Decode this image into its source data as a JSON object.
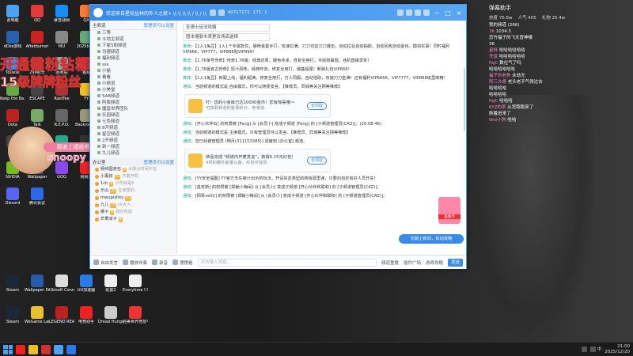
{
  "desktop": {
    "icons": [
      {
        "label": "此电脑",
        "color": "#4aa3f0"
      },
      {
        "label": "QQ",
        "color": "#e03a3a"
      },
      {
        "label": "暴雪战网",
        "color": "#148eff"
      },
      {
        "label": "QA",
        "color": "#ff7a30"
      },
      {
        "label": "dOss游戏",
        "color": "#2a60b0"
      },
      {
        "label": "Afterburner",
        "color": "#c22"
      },
      {
        "label": "MU",
        "color": "#888"
      },
      {
        "label": "2025birth",
        "color": "#6a7"
      },
      {
        "label": "ToDesk",
        "color": "#3a8ae8"
      },
      {
        "label": "299积分",
        "color": "#c33"
      },
      {
        "label": "回收站",
        "color": "#8aa"
      },
      {
        "label": "猫耳",
        "color": "#e33"
      },
      {
        "label": "Keep the Ba...",
        "color": "#6a4"
      },
      {
        "label": "ESCAPE",
        "color": "#444"
      },
      {
        "label": "RaidTee",
        "color": "#a33"
      },
      {
        "label": "YY",
        "color": "#f0c020"
      },
      {
        "label": "Dota",
        "color": "#b22"
      },
      {
        "label": "Talk",
        "color": "#7a6"
      },
      {
        "label": "R.E.P.O.",
        "color": "#666"
      },
      {
        "label": "Backrooms",
        "color": "#997"
      },
      {
        "label": "天下",
        "color": "#444"
      },
      {
        "label": "一起来飞车",
        "color": "#3a9"
      },
      {
        "label": "TorDesk",
        "color": "#2a8"
      },
      {
        "label": "Warframe",
        "color": "#333"
      },
      {
        "label": "NVIDIA",
        "color": "#7b2"
      },
      {
        "label": "Wallpaper",
        "color": "#556"
      },
      {
        "label": "GOG",
        "color": "#8a4ae8"
      },
      {
        "label": "网易云",
        "color": "#e22"
      },
      {
        "label": "Discord",
        "color": "#5865f2"
      },
      {
        "label": "腾讯会议",
        "color": "#2a6ae8"
      }
    ],
    "bottom_icons": [
      {
        "label": "Steam",
        "color": "#1b2838"
      },
      {
        "label": "Wallpaper Engine",
        "color": "#2a5aaa"
      },
      {
        "label": "Ubisoft Connect",
        "color": "#ddd"
      },
      {
        "label": "UU加速器",
        "color": "#2a7ae8"
      },
      {
        "label": "配置2",
        "color": "#eee"
      },
      {
        "label": "Everytime I See a DIN...",
        "color": "#eee"
      },
      {
        "label": "Steam",
        "color": "#1b2838"
      },
      {
        "label": "WeGame Launcher",
        "color": "#e8c030"
      },
      {
        "label": "LEGEND REAL",
        "color": "#b22"
      },
      {
        "label": "电竞助手",
        "color": "#e22"
      },
      {
        "label": "Dread Hunger",
        "color": "#ccc"
      },
      {
        "label": "完美世界竞技平台",
        "color": "#e33"
      }
    ],
    "overlay_line1": "开通钻粉钻粉钻",
    "overlay_line2": "15级牌牌粉丝",
    "sticker_tag": "感谢上墙投喂",
    "sticker_name": "snoopy"
  },
  "app": {
    "title": "欢迎来自星际丛林的外人之家+ \\\\ \\\\ \\\\ \\\\ / \\\\ / \\\\",
    "channel_id": "40717172",
    "online": "171",
    "members": "1",
    "sidebar": {
      "header_left": "主频道",
      "header_right": "管理员可以设置",
      "channels": [
        "三等",
        "斗地主频道",
        "下家5和频道",
        "功德频道",
        "福利频道",
        "sss",
        "小偷",
        "看看",
        "小频道",
        "小美堂",
        "5AB频道",
        "阿瓶频道",
        "魔兽世界团队",
        "乐园频道",
        "七色频道",
        "8开频道",
        "星空频道",
        "2开频道",
        "新一频道",
        "九儿频道"
      ],
      "sub_header_left": "办公室",
      "sub_header_right": "管理员可以设置",
      "users": [
        {
          "name": "杨帅圆克包",
          "tag": "8",
          "extra": "大部分时间不在"
        },
        {
          "name": "小黑叔",
          "tag": "51",
          "extra": "不能开机"
        },
        {
          "name": "1ch",
          "tag": "5",
          "extra": "小号就是5"
        },
        {
          "name": "乐山",
          "tag": "22",
          "extra": "在家里的"
        },
        {
          "name": "mwupishky",
          "tag": "13",
          "extra": ""
        },
        {
          "name": "九儿",
          "tag": "10",
          "extra": "ck大人"
        },
        {
          "name": "挪子",
          "tag": "9",
          "extra": "我在吃饭"
        },
        {
          "name": "芒果凉子",
          "tag": "8",
          "extra": ""
        }
      ]
    },
    "main": {
      "top_inputs": [
        "圣律士玩法攻略",
        "固本堵婴木表更及场高选择"
      ],
      "messages": [
        {
          "prefix": "推荐",
          "text": "【1入1兔豆】1入1个专属款优，硬骨金曼手打，攻速拉满，刀刀切割刀刀爆击，自动拉扯自动抽取，自动回收自动金伐，模拟实事！同时福利VIP666，VIP777，VIP888贴VIP999！"
        },
        {
          "prefix": "推荐",
          "text": "【1.76单号传奇】传奇1.76版，经典还原，硬色传承，修复全用打，平民耐赢题，挂机直播享受！"
        },
        {
          "prefix": "推荐",
          "text": "【1.76版宫古传奇】原汁原味，经典怀旧，修复全用打，爆基超强！新服礼包VIP666！"
        },
        {
          "prefix": "推荐",
          "text": "【1入1兔豆】新服上线，福利超满，修复全用打，万人同服，自动拾取，攻速刀刀金满！还有福利VIP6666，VIP7777，VIP888级里绑精！"
        },
        {
          "prefix": "通知",
          "text": "当前频道的模式是 自由模式，你可以随便发言。【推荐员、同城等关注网等推荐】"
        }
      ],
      "card1": {
        "title": "叮！您的小金库已达10000金币！您有惊喜哦～",
        "sub": "可获取频道的登录积分、参考信",
        "button": "去领取"
      },
      "messages2": [
        {
          "prefix": "通知",
          "text": "[开心伙伴白] 的权限被 [Feng] 从 [会员小] 变成子频道 [Feng] 的 [子频道管理员(CAZ)]。(20:08:46)"
        },
        {
          "prefix": "通知",
          "text": "当前频道的模式是 主席模式，只有管理员可以发言。【推荐员、同城等关注网等推荐】"
        },
        {
          "prefix": "通知",
          "text": "您已经被管理员 [明月(311153385)] 调度到 [办公室] 频道。"
        }
      ],
      "card2": {
        "title": "恭喜完成 \"频道内开麦发言\"，获得0.15元红包！",
        "sub": "4项的额外能量以备，红包可提现",
        "button": "去领取"
      },
      "messages3": [
        {
          "prefix": "通知",
          "text": "[YY安全提醒] YY官方无先审计出示的玩法，开设好友类型的商信源里通，只要向自定有好人员开关！"
        },
        {
          "prefix": "通知",
          "text": "[金克斯] 的权限被 [郑翰小梅闰] 从 [会员小] 变成子频道 [开心伙伴和联和] 的 [子频道管理员(CAZ)]。"
        },
        {
          "prefix": "通知",
          "text": "[网易ve02] 的权限被 [郑翰小梅闰] 从 [会员小] 变成子频道 [开心伙伴和联和] 的 [子频道管理员(CAZ)]。"
        }
      ],
      "gift_label": "送金币",
      "new_msg_button": "无期上新闻，有动攻略"
    },
    "bottom": {
      "items": [
        "自由发言",
        "播放伴奏",
        "录音",
        "摆摆看"
      ],
      "input_placeholder": "点击输入消息...",
      "right_items": [
        "频道重叠",
        "插件广场",
        "游戏攻略"
      ],
      "send": "发送"
    }
  },
  "right_panel": {
    "title": "弹幕助手",
    "stats": [
      "热度 76.6w",
      "人气 405",
      "礼物 25.4w"
    ],
    "lines": [
      {
        "name": "",
        "text": "我的频道 (266)"
      },
      {
        "name": "36",
        "text": "1034.5"
      },
      {
        "name": "",
        "text": "恋竹福子的飞天冒神楼"
      },
      {
        "name": "",
        "text": "36"
      },
      {
        "name": "星畔",
        "text": "哈哈哈哈哈哈"
      },
      {
        "name": "凭借",
        "text": "哈哈哈哈哈哈"
      },
      {
        "name": "FaJC",
        "text": "数位气了吗"
      },
      {
        "name": "",
        "text": "哈哈哈哈哈哈"
      },
      {
        "name": "福子的老狗",
        "text": "永劫无"
      },
      {
        "name": "阿三大眼",
        "text": "老头老不气得过去"
      },
      {
        "name": "",
        "text": "哈哈哈哈"
      },
      {
        "name": "",
        "text": "哈哈哈哈"
      },
      {
        "name": "FaJC",
        "text": "哈哈哈"
      },
      {
        "name": "KYZ的茶",
        "text": "从宫跑跑来了"
      },
      {
        "name": "",
        "text": "刷着进来了"
      },
      {
        "name": "Nini小狗",
        "text": "哈哈"
      }
    ]
  },
  "taskbar": {
    "time": "21:00",
    "date": "2025/12/20",
    "lang": "中",
    "apps": [
      "#e22",
      "#f0c020",
      "#c33",
      "#4aa3f0",
      "#2a7ae8"
    ]
  }
}
